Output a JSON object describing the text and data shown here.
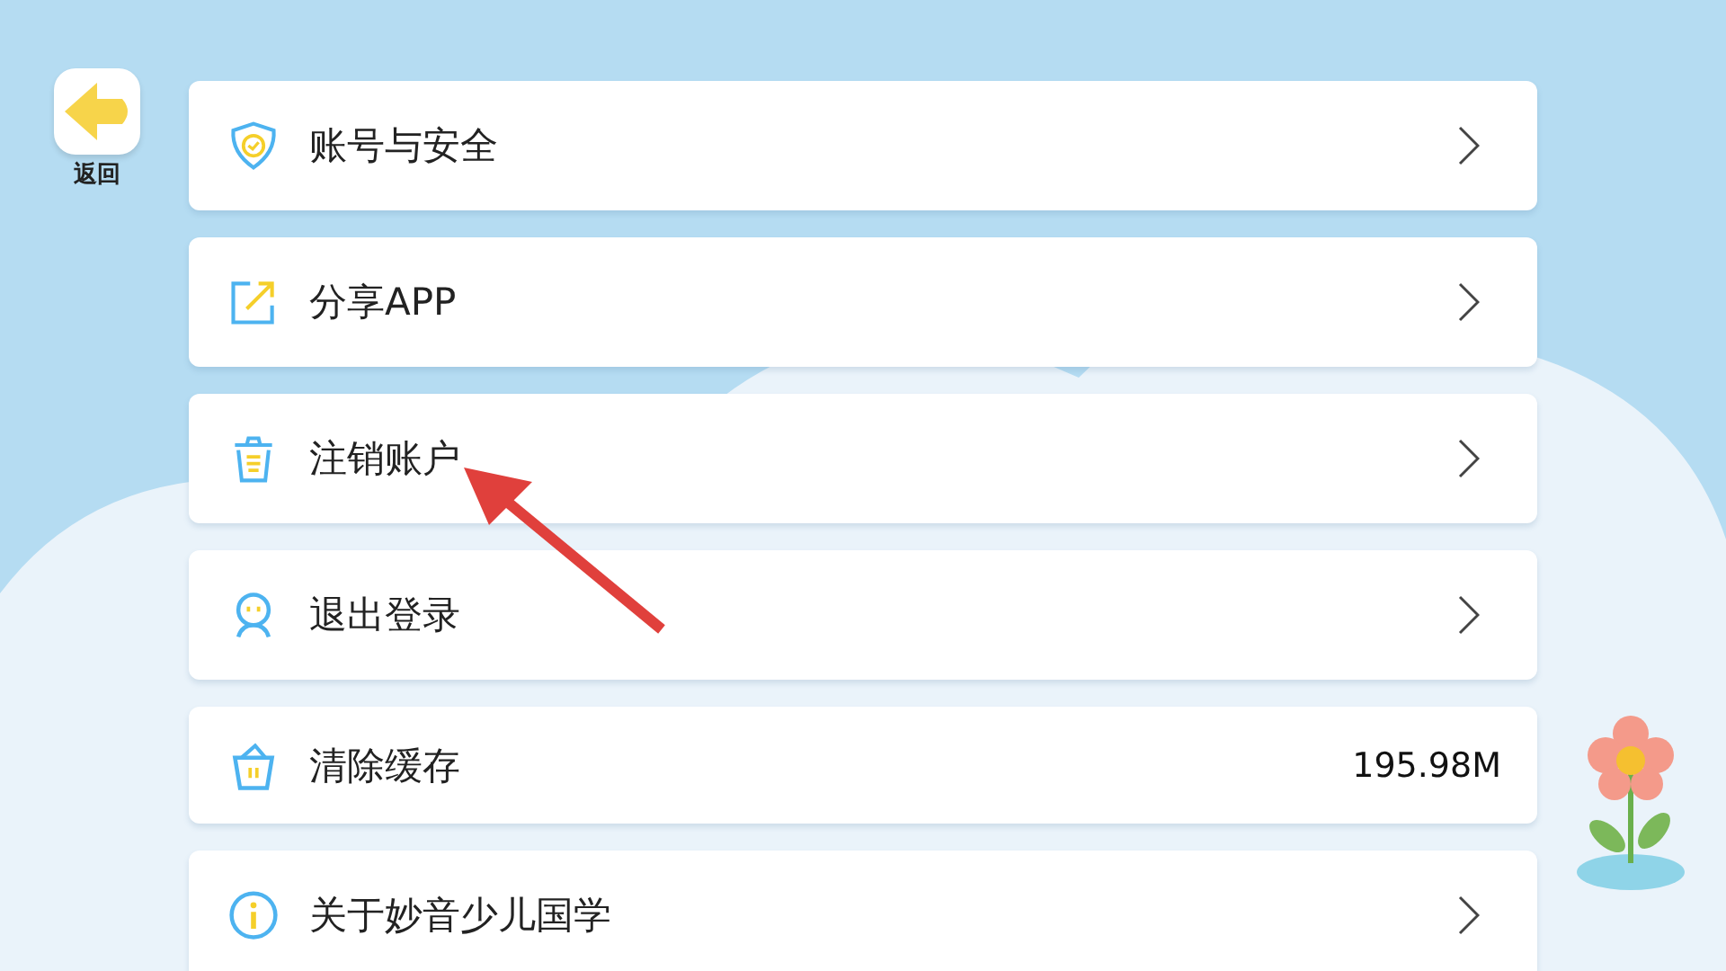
{
  "back_button": {
    "label": "返回"
  },
  "settings": [
    {
      "kind": "chevron",
      "label": "账号与安全"
    },
    {
      "kind": "chevron",
      "label": "分享APP"
    },
    {
      "kind": "chevron",
      "label": "注销账户"
    },
    {
      "kind": "chevron",
      "label": "退出登录"
    },
    {
      "kind": "value",
      "label": "清除缓存",
      "value": "195.98M"
    },
    {
      "kind": "chevron",
      "label": "关于妙音少儿国学"
    }
  ]
}
